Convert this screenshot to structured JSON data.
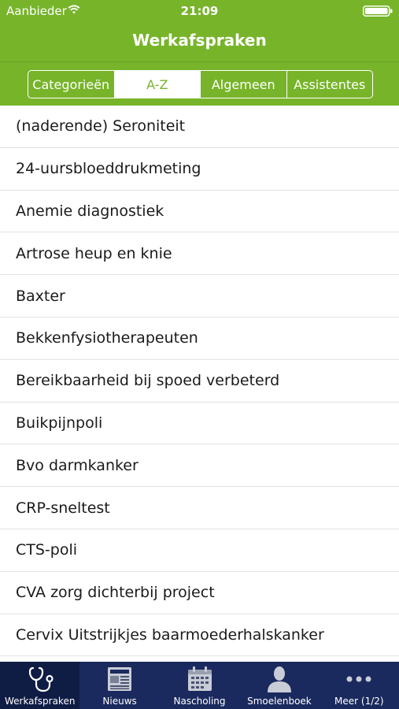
{
  "status_bar": {
    "carrier": "Aanbieder",
    "time": "21:09",
    "wifi_icon": "wifi-icon",
    "battery_icon": "battery-icon"
  },
  "nav": {
    "title": "Werkafspraken"
  },
  "segments": [
    {
      "label": "Categorieën",
      "active": false
    },
    {
      "label": "A-Z",
      "active": true
    },
    {
      "label": "Algemeen",
      "active": false
    },
    {
      "label": "Assistentes",
      "active": false
    }
  ],
  "items": [
    "(naderende) Seroniteit",
    "24-uursbloeddrukmeting",
    "Anemie diagnostiek",
    "Artrose heup en knie",
    "Baxter",
    "Bekkenfysiotherapeuten",
    "Bereikbaarheid bij spoed verbeterd",
    "Buikpijnpoli",
    "Bvo darmkanker",
    "CRP-sneltest",
    "CTS-poli",
    "CVA zorg dichterbij project",
    "Cervix Uitstrijkjes baarmoederhalskanker"
  ],
  "tabs": [
    {
      "label": "Werkafspraken",
      "icon": "stethoscope-icon",
      "active": true
    },
    {
      "label": "Nieuws",
      "icon": "newspaper-icon",
      "active": false
    },
    {
      "label": "Nascholing",
      "icon": "calendar-icon",
      "active": false
    },
    {
      "label": "Smoelenboek",
      "icon": "person-icon",
      "active": false
    },
    {
      "label": "Meer (1/2)",
      "icon": "more-icon",
      "active": false
    }
  ],
  "colors": {
    "accent_green": "#77b42a",
    "tabbar_navy": "#1a2a5e"
  }
}
